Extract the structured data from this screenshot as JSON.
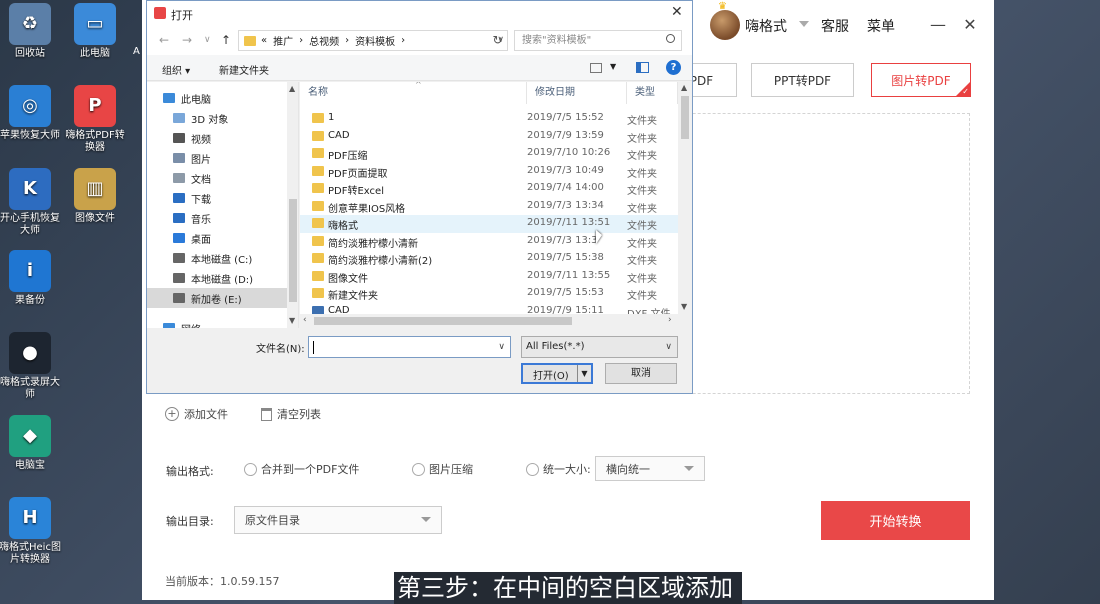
{
  "desktop": {
    "icons": [
      {
        "label": "回收站",
        "color": "#5b7fa8",
        "glyph": "♻"
      },
      {
        "label": "此电脑",
        "color": "#3b8ad9",
        "glyph": "▭"
      },
      {
        "label": "苹果恢复大师",
        "color": "#2a7fd4",
        "glyph": "◎"
      },
      {
        "label": "嗨格式PDF转换器",
        "color": "#e84545",
        "glyph": "P"
      },
      {
        "label": "开心手机恢复大师",
        "color": "#2d6cc0",
        "glyph": "K"
      },
      {
        "label": "图像文件",
        "color": "#c9a24a",
        "glyph": "▥"
      },
      {
        "label": "果备份",
        "color": "#1f76d2",
        "glyph": "i"
      },
      {
        "label": "嗨格式录屏大师",
        "color": "#1d2530",
        "glyph": "●"
      },
      {
        "label": "电脑宝",
        "color": "#20a080",
        "glyph": "◆"
      },
      {
        "label": "嗨格式Heic图片转换器",
        "color": "#2a84d8",
        "glyph": "H"
      }
    ],
    "edge_text": "A"
  },
  "app": {
    "user_name": "嗨格式",
    "service": "客服",
    "menu": "菜单",
    "minimize": "—",
    "close": "✕",
    "modes": [
      {
        "label": "转PDF",
        "active": false
      },
      {
        "label": "PPT转PDF",
        "active": false
      },
      {
        "label": "图片转PDF",
        "active": true
      }
    ],
    "add_file": "添加文件",
    "clear_list": "清空列表",
    "output_format_label": "输出格式:",
    "format_options": [
      "合并到一个PDF文件",
      "图片压缩",
      "统一大小:"
    ],
    "size_select": "横向统一",
    "output_dir_label": "输出目录:",
    "output_dir": "原文件目录",
    "start": "开始转换",
    "version": "当前版本：1.0.59.157",
    "accent": "#e94848"
  },
  "subtitle": "第三步：在中间的空白区域添加",
  "dialog": {
    "title": "打开",
    "close": "✕",
    "nav": {
      "back": "←",
      "forward": "→",
      "dropdown": "∨",
      "up": "↑"
    },
    "breadcrumb": [
      "«",
      "推广",
      "›",
      "总视频",
      "›",
      "资料模板",
      "›"
    ],
    "search_placeholder": "搜索\"资料模板\"",
    "organize": "组织 ▾",
    "new_folder": "新建文件夹",
    "help": "?",
    "sidebar": [
      {
        "label": "此电脑",
        "color": "#3b8ad9",
        "selected": false
      },
      {
        "label": "3D 对象",
        "color": "#7aa7d9",
        "selected": false
      },
      {
        "label": "视频",
        "color": "#555555",
        "selected": false
      },
      {
        "label": "图片",
        "color": "#7a8ea8",
        "selected": false
      },
      {
        "label": "文档",
        "color": "#8d9aa8",
        "selected": false
      },
      {
        "label": "下载",
        "color": "#2b6ec2",
        "selected": false
      },
      {
        "label": "音乐",
        "color": "#2b6ec2",
        "selected": false
      },
      {
        "label": "桌面",
        "color": "#2b7ad9",
        "selected": false
      },
      {
        "label": "本地磁盘 (C:)",
        "color": "#666666",
        "selected": false
      },
      {
        "label": "本地磁盘 (D:)",
        "color": "#666666",
        "selected": false
      },
      {
        "label": "新加卷 (E:)",
        "color": "#666666",
        "selected": true
      },
      {
        "label": "网络",
        "color": "#3b8ad9",
        "selected": false
      }
    ],
    "columns": [
      "名称",
      "修改日期",
      "类型"
    ],
    "files": [
      {
        "name": "1",
        "date": "2019/7/5 15:52",
        "type": "文件夹",
        "kind": "folder"
      },
      {
        "name": "CAD",
        "date": "2019/7/9 13:59",
        "type": "文件夹",
        "kind": "folder"
      },
      {
        "name": "PDF压缩",
        "date": "2019/7/10 10:26",
        "type": "文件夹",
        "kind": "folder"
      },
      {
        "name": "PDF页面提取",
        "date": "2019/7/3 10:49",
        "type": "文件夹",
        "kind": "folder"
      },
      {
        "name": "PDF转Excel",
        "date": "2019/7/4 14:00",
        "type": "文件夹",
        "kind": "folder"
      },
      {
        "name": "创意苹果IOS风格",
        "date": "2019/7/3 13:34",
        "type": "文件夹",
        "kind": "folder"
      },
      {
        "name": "嗨格式",
        "date": "2019/7/11 13:51",
        "type": "文件夹",
        "kind": "folder",
        "hover": true
      },
      {
        "name": "简约淡雅柠檬小清新",
        "date": "2019/7/3 13:3",
        "type": "文件夹",
        "kind": "folder"
      },
      {
        "name": "简约淡雅柠檬小清新(2)",
        "date": "2019/7/5 15:38",
        "type": "文件夹",
        "kind": "folder"
      },
      {
        "name": "图像文件",
        "date": "2019/7/11 13:55",
        "type": "文件夹",
        "kind": "folder"
      },
      {
        "name": "新建文件夹",
        "date": "2019/7/5 15:53",
        "type": "文件夹",
        "kind": "folder"
      },
      {
        "name": "CAD",
        "date": "2019/7/9 15:11",
        "type": "DXF 文件",
        "kind": "dxf"
      }
    ],
    "filename_label": "文件名(N):",
    "filename_value": "",
    "filter": "All Files(*.*)",
    "open": "打开(O)",
    "cancel": "取消"
  }
}
